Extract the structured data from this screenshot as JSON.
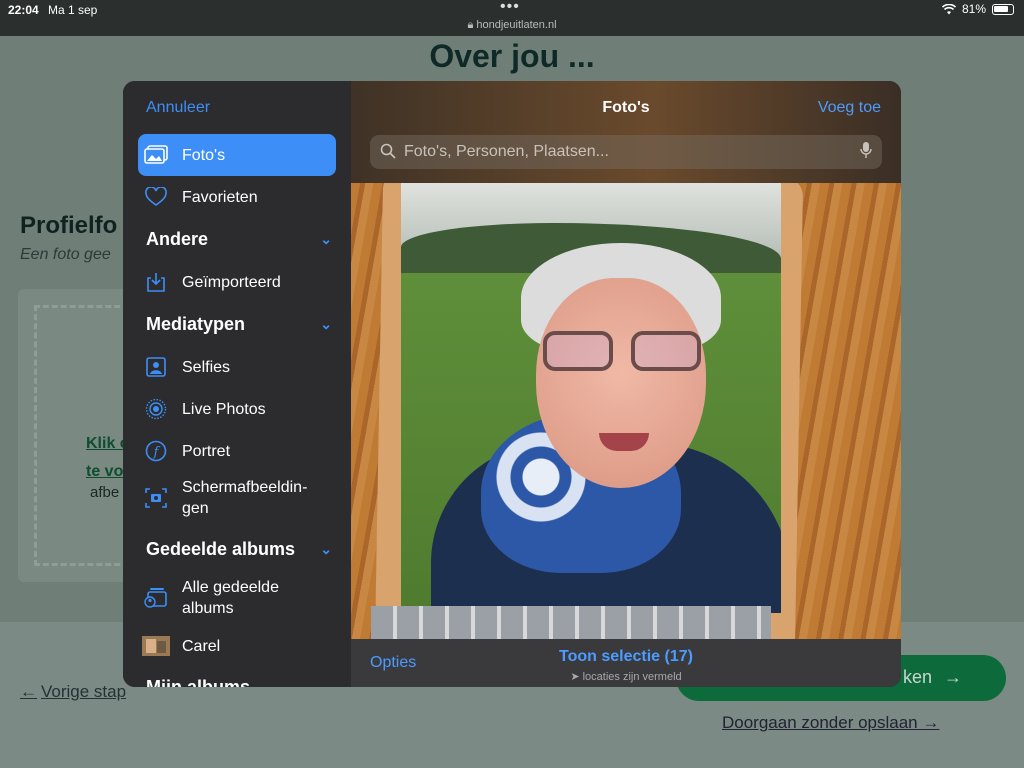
{
  "status_bar": {
    "time": "22:04",
    "date": "Ma 1 sep",
    "url": "hondjeuitlaten.nl",
    "battery": "81%",
    "icons": [
      "dots-icon",
      "lock-icon",
      "wifi-icon",
      "battery-icon"
    ]
  },
  "webpage": {
    "heading": "Over jou ...",
    "profile_title": "Profielfo",
    "profile_subtitle": "Een foto gee",
    "upload_link_1": "Klik o",
    "upload_link_2": "te vo",
    "upload_hint": "afbe",
    "prev_arrow": "←",
    "prev_step": "Vorige stap",
    "save_button_partial": "ken",
    "save_arrow": "→",
    "skip_link": "Doorgaan zonder opslaan",
    "skip_arrow": "→"
  },
  "picker": {
    "cancel": "Annuleer",
    "title": "Foto's",
    "add": "Voeg toe",
    "search_placeholder": "Foto's, Personen, Plaatsen...",
    "sidebar": {
      "items": [
        {
          "label": "Foto's",
          "icon": "photos-icon",
          "active": true
        },
        {
          "label": "Favorieten",
          "icon": "heart-icon"
        }
      ],
      "sections": [
        {
          "title": "Andere",
          "items": [
            {
              "label": "Geïmporteerd",
              "icon": "import-icon"
            }
          ]
        },
        {
          "title": "Mediatypen",
          "items": [
            {
              "label": "Selfies",
              "icon": "selfie-icon"
            },
            {
              "label": "Live Photos",
              "icon": "live-photos-icon"
            },
            {
              "label": "Portret",
              "icon": "portrait-icon"
            },
            {
              "label_line1": "Schermafbeeldin-",
              "label_line2": "gen",
              "icon": "screenshot-icon"
            }
          ]
        },
        {
          "title": "Gedeelde albums",
          "items": [
            {
              "label_line1": "Alle gedeelde",
              "label_line2": "albums",
              "icon": "shared-albums-icon"
            },
            {
              "label": "Carel",
              "icon": "album-thumbnail"
            }
          ]
        },
        {
          "title": "Mijn albums",
          "items": []
        }
      ]
    },
    "bottom": {
      "options": "Opties",
      "selection": "Toon selectie (17)",
      "location_note": "locaties zijn vermeld"
    },
    "colors": {
      "accent": "#3d8ff7",
      "sidebar_bg": "#2c2c2e"
    }
  }
}
